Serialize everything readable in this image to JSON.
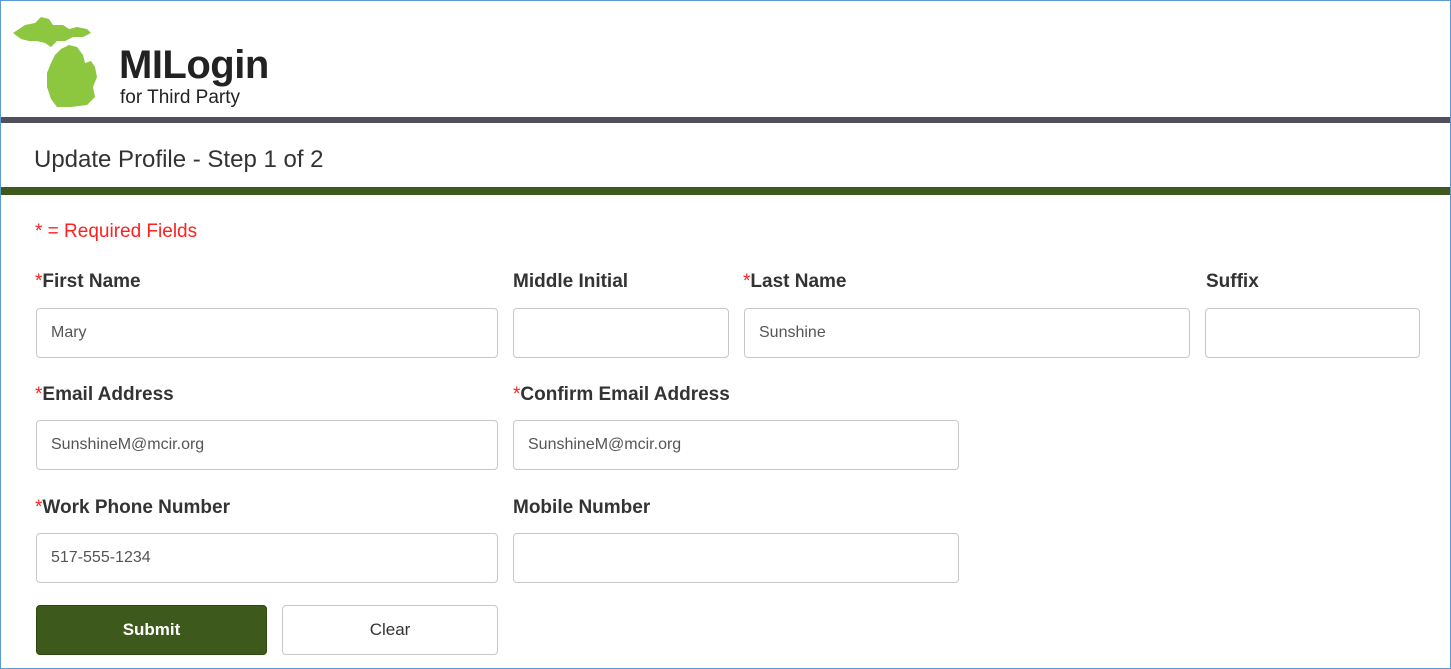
{
  "header": {
    "logo_title": "MILogin",
    "logo_subtitle": "for Third Party",
    "brand_green": "#8dc63f",
    "bar_gray": "#4f4f5d",
    "bar_green": "#3d5a1c",
    "logo_icon": "michigan-map-icon"
  },
  "page": {
    "title": "Update Profile - Step 1 of 2",
    "required_note": "* = Required Fields"
  },
  "form": {
    "required_marker": "*",
    "first_name": {
      "label": "First Name",
      "value": "Mary",
      "required": true
    },
    "middle_initial": {
      "label": "Middle Initial",
      "value": "",
      "required": false
    },
    "last_name": {
      "label": "Last Name",
      "value": "Sunshine",
      "required": true
    },
    "suffix": {
      "label": "Suffix",
      "value": "",
      "required": false
    },
    "email": {
      "label": "Email Address",
      "value": "SunshineM@mcir.org",
      "required": true
    },
    "confirm_email": {
      "label": "Confirm Email Address",
      "value": "SunshineM@mcir.org",
      "required": true
    },
    "work_phone": {
      "label": "Work Phone Number",
      "value": "517-555-1234",
      "required": true
    },
    "mobile": {
      "label": "Mobile Number",
      "value": "",
      "required": false
    },
    "submit_label": "Submit",
    "clear_label": "Clear"
  }
}
